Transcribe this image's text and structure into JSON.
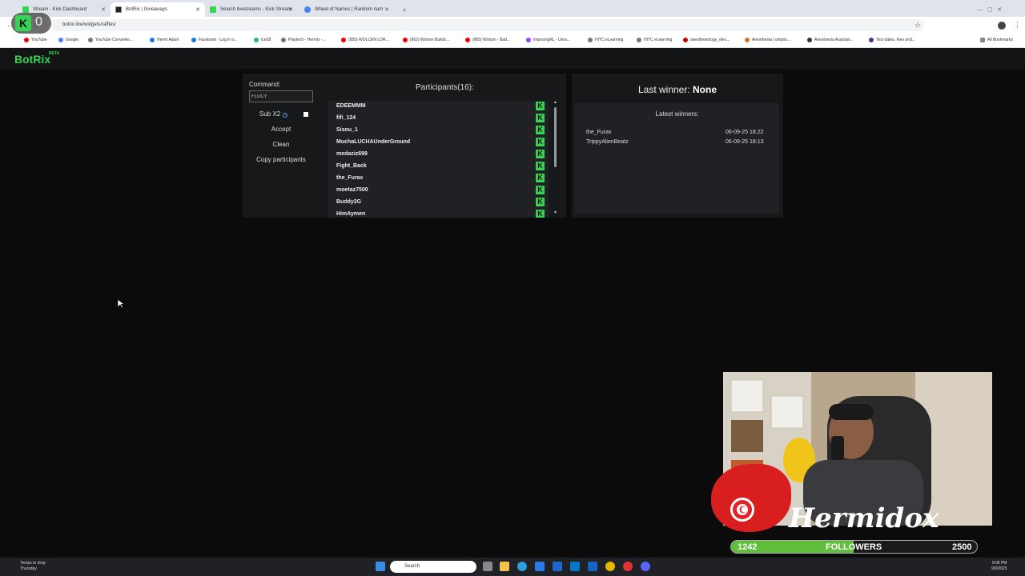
{
  "browser": {
    "tabs": [
      {
        "title": "Stream - Kick Dashboard",
        "color": "#39d353"
      },
      {
        "title": "BotRix | Giveaways",
        "color": "#222222"
      },
      {
        "title": "Search livestreams - Kick Stream",
        "color": "#39d353"
      },
      {
        "title": "Wheel of Names | Random nam",
        "color": "#4285f4"
      }
    ],
    "url": "botrix.live/widgets/raffles/",
    "bookmarks": [
      "YouTube",
      "Google",
      "YouTube Converter...",
      "Hermi Adam",
      "Facebook - Log in o...",
      "Ice38",
      "Playtech - Hermix -...",
      "(855) WOLCEN LOR...",
      "(862) Wolcen Builds:...",
      "(865) Wolcen - Batt...",
      "ImposingRL - Unra...",
      "HITC eLearning",
      "HITC eLearning",
      "anesthesiology_elec...",
      "Anesthesia | ontario...",
      "Anesthesia Assistan...",
      "Test dates, fees and...",
      "All Bookmarks"
    ]
  },
  "overlay": {
    "counter": "0"
  },
  "app": {
    "logo": "BotRix",
    "beta": "BETA"
  },
  "raffle": {
    "command_label": "Command:",
    "command_value": "FLUCY",
    "sub_label": "Sub X2",
    "accept": "Accept",
    "clean": "Clean",
    "copy": "Copy participants",
    "participants_title": "Participants(16):",
    "participants": [
      "EDEEMMM",
      "fifi_124",
      "Sisou_1",
      "MuchaLUCHAUnderGround",
      "medaziz699",
      "Fight_Back",
      "the_Furax",
      "moetaz7500",
      "Buddy2G",
      "HimAymen"
    ]
  },
  "winners": {
    "last_label": "Last winner:",
    "last_value": "None",
    "latest_label": "Latest winners:",
    "list": [
      {
        "name": "the_Furax",
        "date": "06-09-25 18:22"
      },
      {
        "name": "TrippyAlienBeatz",
        "date": "06-09-25 18:13"
      }
    ]
  },
  "stream": {
    "name": "Hermidox",
    "followers_count": "1242",
    "followers_label": "FOLLOWERS",
    "followers_goal": "2500",
    "progress_fraction": 0.4968
  },
  "taskbar": {
    "weather_title": "Temps to drop",
    "weather_sub": "Thursday",
    "search": "Search",
    "time": "9:08 PM",
    "date": "9/9/2025"
  }
}
